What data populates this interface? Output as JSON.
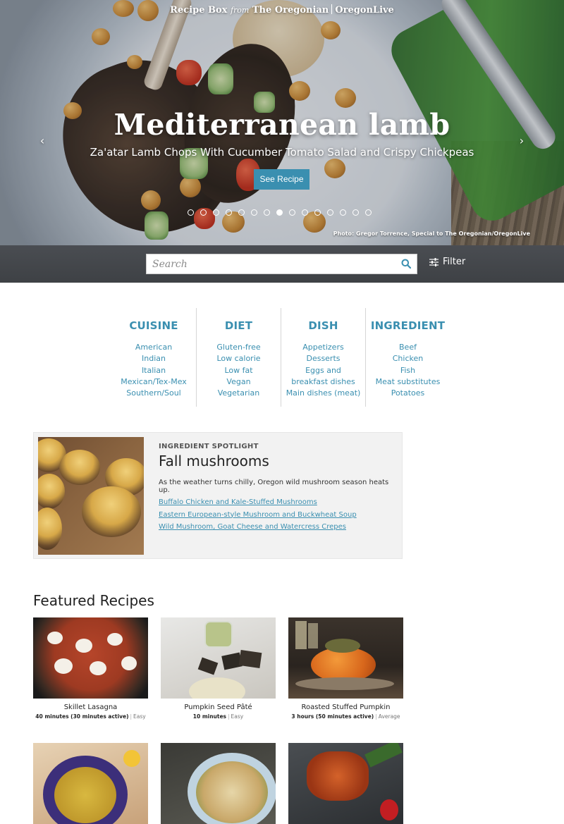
{
  "header": {
    "brand_left": "Recipe Box",
    "brand_from": "from",
    "brand_paper": "The Oregonian",
    "brand_site": "OregonLive"
  },
  "hero": {
    "title": "Mediterranean lamb",
    "subtitle": "Za'atar Lamb Chops With Cucumber Tomato Salad and Crispy Chickpeas",
    "button_label": "See Recipe",
    "prev_icon": "chevron-left-icon",
    "next_icon": "chevron-right-icon",
    "slide_count": 15,
    "active_slide": 8,
    "photo_credit": "Photo: Gregor Torrence, Special to The Oregonian/OregonLive"
  },
  "search": {
    "placeholder": "Search",
    "icon": "search-icon",
    "filter_label": "Filter",
    "filter_icon": "sliders-icon"
  },
  "categories": [
    {
      "title": "CUISINE",
      "items": [
        "American",
        "Indian",
        "Italian",
        "Mexican/Tex-Mex",
        "Southern/Soul"
      ]
    },
    {
      "title": "DIET",
      "items": [
        "Gluten-free",
        "Low calorie",
        "Low fat",
        "Vegan",
        "Vegetarian"
      ]
    },
    {
      "title": "DISH",
      "items": [
        "Appetizers",
        "Desserts",
        "Eggs and breakfast dishes",
        "Main dishes (meat)"
      ]
    },
    {
      "title": "INGREDIENT",
      "items": [
        "Beef",
        "Chicken",
        "Fish",
        "Meat substitutes",
        "Potatoes"
      ]
    }
  ],
  "spotlight": {
    "label": "INGREDIENT SPOTLIGHT",
    "title": "Fall mushrooms",
    "description": "As the weather turns chilly, Oregon wild mushroom season heats up.",
    "links": [
      "Buffalo Chicken and Kale-Stuffed Mushrooms",
      "Eastern European-style Mushroom and Buckwheat Soup",
      "Wild Mushroom, Goat Cheese and Watercress Crepes"
    ]
  },
  "featured": {
    "title": "Featured Recipes",
    "recipes": [
      {
        "name": "Skillet Lasagna",
        "time": "40 minutes (30 minutes active)",
        "level": "Easy"
      },
      {
        "name": "Pumpkin Seed Pâté",
        "time": "10 minutes",
        "level": "Easy"
      },
      {
        "name": "Roasted Stuffed Pumpkin",
        "time": "3 hours (50 minutes active)",
        "level": "Average"
      }
    ]
  },
  "colors": {
    "accent": "#3a8fb0",
    "search_bar": "#45484c"
  }
}
